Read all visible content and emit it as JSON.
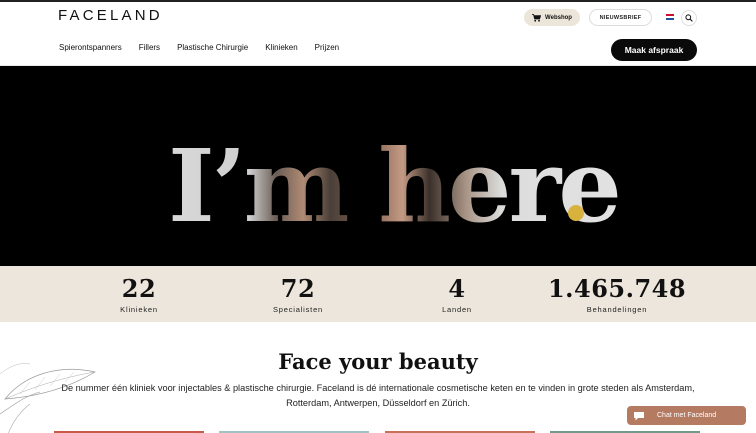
{
  "header": {
    "logo": "FACELAND",
    "webshop_label": "Webshop",
    "newsletter_label": "NIEUWSBRIEF",
    "cta_label": "Maak afspraak",
    "nav": [
      "Spierontspanners",
      "Fillers",
      "Plastische Chirurgie",
      "Klinieken",
      "Prijzen"
    ]
  },
  "hero": {
    "headline": "I’m here",
    "dot": ".",
    "dot_color": "#d9b23e"
  },
  "stats": [
    {
      "value": "22",
      "label": "Klinieken"
    },
    {
      "value": "72",
      "label": "Specialisten"
    },
    {
      "value": "4",
      "label": "Landen"
    },
    {
      "value": "1.465.748",
      "label": "Behandelingen"
    }
  ],
  "content": {
    "title": "Face your beauty",
    "intro": "De nummer één kliniek voor injectables & plastische chirurgie. Faceland is dé internationale cosmetische keten en te vinden in grote steden als Amsterdam, Rotterdam, Antwerpen, Düsseldorf en Zürich."
  },
  "chat": {
    "label": "Chat met Faceland",
    "color": "#b47a62"
  }
}
